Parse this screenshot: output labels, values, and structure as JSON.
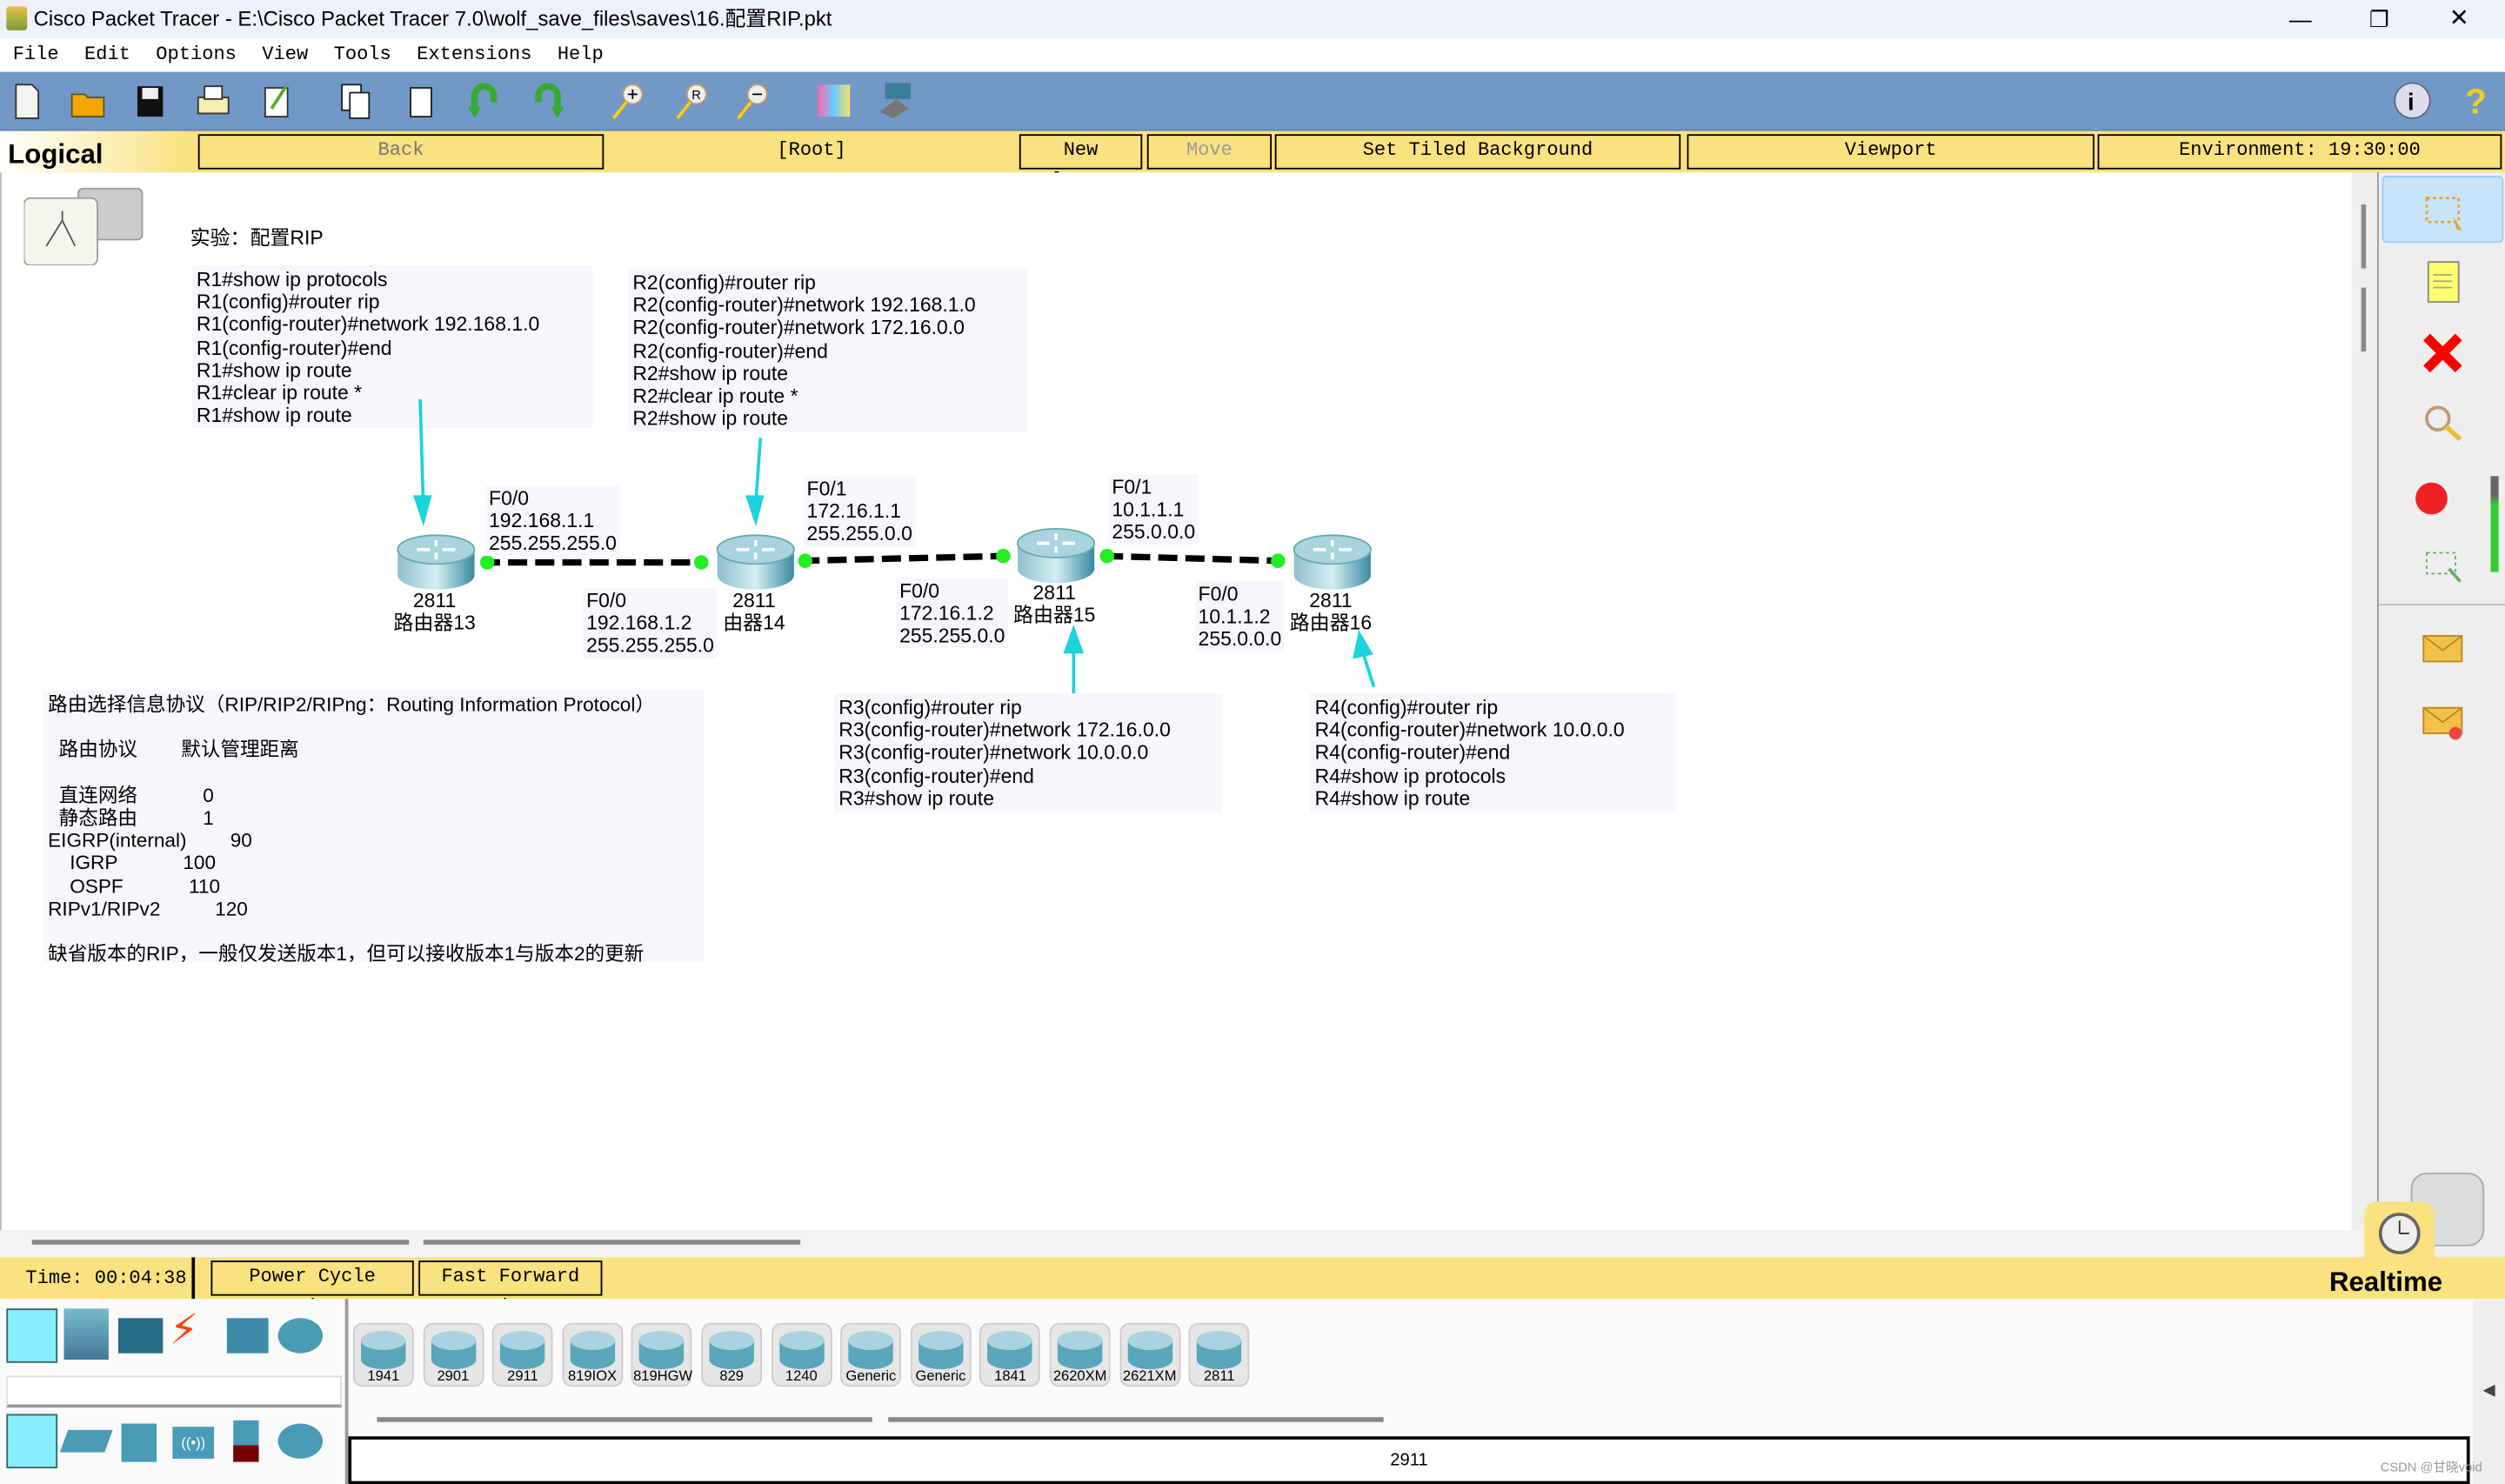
{
  "window": {
    "title": "Cisco Packet Tracer - E:\\Cisco Packet Tracer 7.0\\wolf_save_files\\saves\\16.配置RIP.pkt",
    "controls": [
      "—",
      "❐",
      "✕"
    ]
  },
  "menu": [
    "File",
    "Edit",
    "Options",
    "View",
    "Tools",
    "Extensions",
    "Help"
  ],
  "toolbar": {
    "icons": [
      "new-file-icon",
      "open-folder-icon",
      "save-icon",
      "print-icon",
      "activity-wizard-icon",
      "copy-icon",
      "paste-icon",
      "undo-icon",
      "redo-icon",
      "zoom-in-icon",
      "zoom-reset-icon",
      "zoom-out-icon",
      "palette-icon",
      "custom-device-icon",
      "info-icon",
      "help-icon"
    ]
  },
  "workspace_bar": {
    "mode": "Logical",
    "back": "Back",
    "root": "[Root]",
    "new_cluster": "New Cluster",
    "move_object": "Move Object",
    "tiled_bg": "Set Tiled Background",
    "viewport": "Viewport",
    "environment": "Environment: 19:30:00"
  },
  "canvas": {
    "heading": "实验：配置RIP",
    "notes": {
      "r1": "R1#show ip protocols\nR1(config)#router rip\nR1(config-router)#network 192.168.1.0\nR1(config-router)#end\nR1#show ip route\nR1#clear ip route *\nR1#show ip route",
      "r2": "R2(config)#router rip\nR2(config-router)#network 192.168.1.0\nR2(config-router)#network 172.16.0.0\nR2(config-router)#end\nR2#show ip route\nR2#clear ip route *\nR2#show ip route",
      "r3": "R3(config)#router rip\nR3(config-router)#network 172.16.0.0\nR3(config-router)#network 10.0.0.0\nR3(config-router)#end\nR3#show ip route",
      "r4": "R4(config)#router rip\nR4(config-router)#network 10.0.0.0\nR4(config-router)#end\nR4#show ip protocols\nR4#show ip route",
      "info": "路由选择信息协议（RIP/RIP2/RIPng：Routing Information Protocol）\n\n  路由协议        默认管理距离\n\n  直连网络            0\n  静态路由            1\nEIGRP(internal)        90\n    IGRP            100\n    OSPF            110\nRIPv1/RIPv2          120\n\n缺省版本的RIP，一般仅发送版本1，但可以接收版本1与版本2的更新"
    },
    "interfaces": [
      {
        "text": "F0/0\n192.168.1.1\n255.255.255.0"
      },
      {
        "text": "F0/0\n192.168.1.2\n255.255.255.0"
      },
      {
        "text": "F0/1\n172.16.1.1\n255.255.0.0"
      },
      {
        "text": "F0/0\n172.16.1.2\n255.255.0.0"
      },
      {
        "text": "F0/1\n10.1.1.1\n255.0.0.0"
      },
      {
        "text": "F0/0\n10.1.1.2\n255.0.0.0"
      }
    ],
    "routers": [
      {
        "model": "2811",
        "name": "路由器13"
      },
      {
        "model": "2811",
        "name": "由器14"
      },
      {
        "model": "2811",
        "name": "路由器15"
      },
      {
        "model": "2811",
        "name": "路由器16"
      }
    ],
    "colors": {
      "link": "#000000",
      "link_up": "#22dd22",
      "arrow": "#1ad3dc"
    }
  },
  "right_panel": [
    "select-icon",
    "note-icon",
    "delete-icon",
    "inspect-icon",
    "draw-ellipse-icon",
    "resize-icon",
    "simple-pdu-icon",
    "complex-pdu-icon"
  ],
  "bottom_bar": {
    "time": "Time: 00:04:38",
    "power_cycle": "Power Cycle Devices",
    "fast_forward": "Fast Forward Time",
    "mode": "Realtime"
  },
  "devices": {
    "models": [
      "1941",
      "2901",
      "2911",
      "819IOX",
      "819HGW",
      "829",
      "1240",
      "Generic",
      "Generic",
      "1841",
      "2620XM",
      "2621XM",
      "2811"
    ],
    "selected_label": "2911"
  },
  "watermark": "CSDN @甘晓void"
}
